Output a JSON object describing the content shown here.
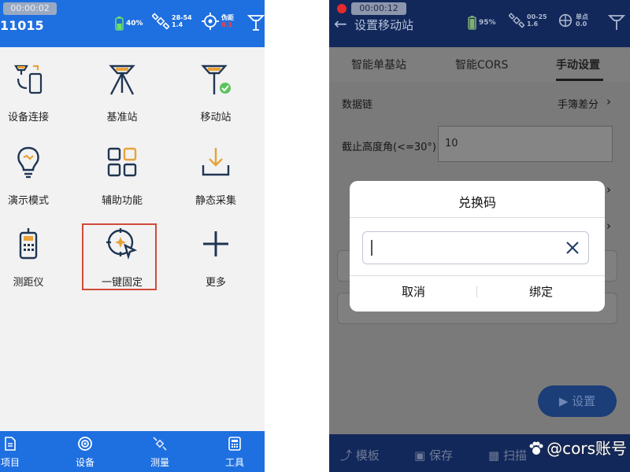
{
  "left_screen": {
    "recording_time": "00:00:02",
    "device_id": "11015",
    "status": {
      "battery": "40%",
      "satellites": "28-54",
      "pdop": "1.4",
      "solution": "伪距",
      "solution_sub": "0.1"
    },
    "grid": [
      {
        "label": "设备连接",
        "icon": "device-connect-icon"
      },
      {
        "label": "基准站",
        "icon": "base-station-icon"
      },
      {
        "label": "移动站",
        "icon": "rover-station-icon"
      },
      {
        "label": "演示模式",
        "icon": "lightbulb-icon"
      },
      {
        "label": "辅助功能",
        "icon": "grid-squares-icon"
      },
      {
        "label": "静态采集",
        "icon": "download-tray-icon"
      },
      {
        "label": "测距仪",
        "icon": "rangefinder-icon"
      },
      {
        "label": "一键固定",
        "icon": "crosshair-cursor-icon"
      },
      {
        "label": "更多",
        "icon": "plus-icon"
      }
    ],
    "bottom_tabs": [
      {
        "label": "项目",
        "icon": "project-icon"
      },
      {
        "label": "设备",
        "icon": "device-icon"
      },
      {
        "label": "测量",
        "icon": "survey-icon"
      },
      {
        "label": "工具",
        "icon": "tools-icon"
      }
    ],
    "colors": {
      "primary": "#1e6fe0",
      "highlight_box": "#d04a3a"
    }
  },
  "right_screen": {
    "recording_time": "00:00:12",
    "page_title": "设置移动站",
    "status": {
      "battery": "95%",
      "satellites": "00-25",
      "pdop": "1.6",
      "solution": "单点",
      "solution_sub": "0.0"
    },
    "tabs": [
      "智能单基站",
      "智能CORS",
      "手动设置"
    ],
    "active_tab": "手动设置",
    "rows": {
      "data_link_label": "数据链",
      "data_link_value": "手簿差分",
      "cutoff_label": "截止高度角(<=30°)",
      "cutoff_value": "10"
    },
    "dialog": {
      "title": "兑换码",
      "input_value": "",
      "cancel_label": "取消",
      "bind_label": "绑定"
    },
    "set_button": "设置",
    "bottom_tabs": [
      "模板",
      "保存",
      "扫描"
    ],
    "watermark": "@cors账号"
  }
}
